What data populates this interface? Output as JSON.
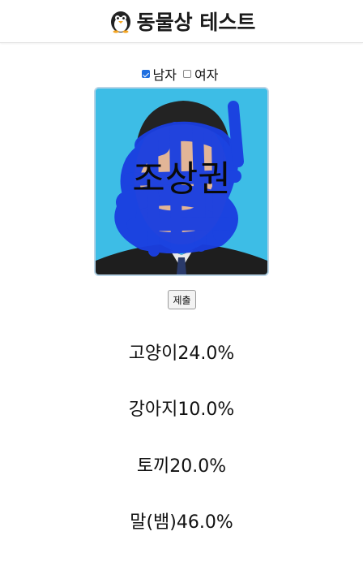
{
  "header": {
    "title": "동물상 테스트",
    "logo_icon": "penguin-icon"
  },
  "gender": {
    "options": [
      {
        "label": "남자",
        "checked": true
      },
      {
        "label": "여자",
        "checked": false
      }
    ]
  },
  "photo": {
    "overlay_text": "조상권"
  },
  "submit": {
    "label": "제출"
  },
  "results": [
    {
      "text": "고양이24.0%"
    },
    {
      "text": "강아지10.0%"
    },
    {
      "text": "토끼20.0%"
    },
    {
      "text": "말(뱀)46.0%"
    }
  ],
  "colors": {
    "checkbox_accent": "#1f6fe0",
    "photo_bg": "#3dbde6",
    "scribble": "#1a3fe0"
  }
}
